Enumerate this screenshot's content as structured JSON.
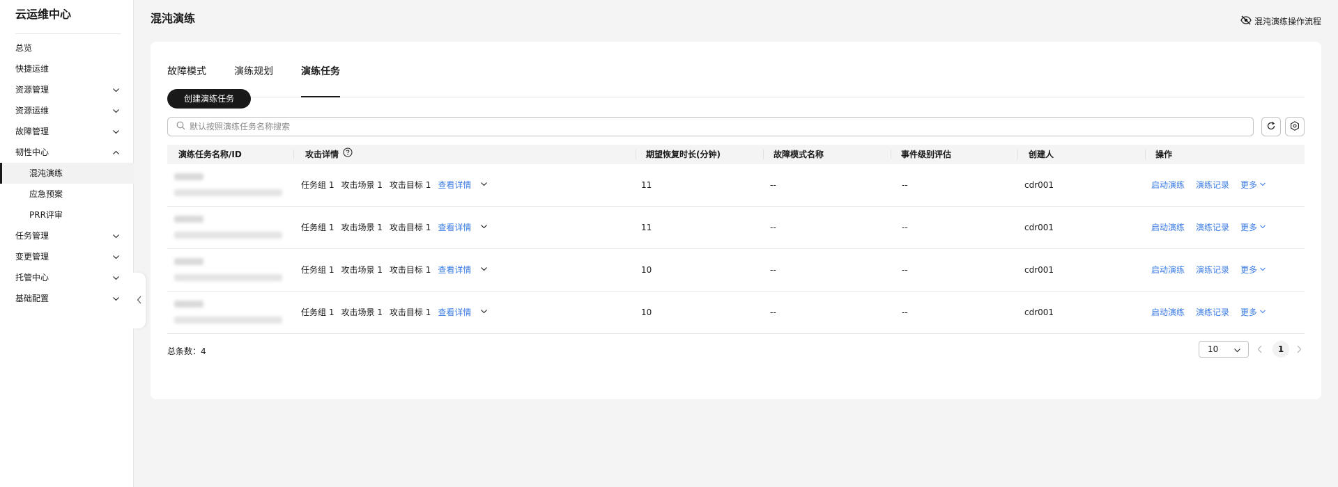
{
  "sidebar": {
    "title": "云运维中心",
    "items": [
      {
        "label": "总览",
        "chevron": "none"
      },
      {
        "label": "快捷运维",
        "chevron": "none"
      },
      {
        "label": "资源管理",
        "chevron": "down"
      },
      {
        "label": "资源运维",
        "chevron": "down"
      },
      {
        "label": "故障管理",
        "chevron": "down"
      },
      {
        "label": "韧性中心",
        "chevron": "up"
      },
      {
        "label": "混沌演练",
        "sub": true,
        "active": true
      },
      {
        "label": "应急预案",
        "sub": true
      },
      {
        "label": "PRR评审",
        "sub": true
      },
      {
        "label": "任务管理",
        "chevron": "down"
      },
      {
        "label": "变更管理",
        "chevron": "down"
      },
      {
        "label": "托管中心",
        "chevron": "down"
      },
      {
        "label": "基础配置",
        "chevron": "down"
      }
    ]
  },
  "header": {
    "title": "混沌演练",
    "flow_link": "混沌演练操作流程",
    "flow_icon": "eye-off-icon"
  },
  "tabs": [
    "故障模式",
    "演练规划",
    "演练任务"
  ],
  "active_tab": "演练任务",
  "toolbar": {
    "create_label": "创建演练任务",
    "search_placeholder": "默认按照演练任务名称搜索"
  },
  "table": {
    "headers": [
      "演练任务名称/ID",
      "攻击详情",
      "期望恢复时长(分钟)",
      "故障模式名称",
      "事件级别评估",
      "创建人",
      "操作"
    ],
    "rows": [
      {
        "attack": [
          "任务组 1",
          "攻击场景 1",
          "攻击目标 1"
        ],
        "detail_link": "查看详情",
        "recovery": "11",
        "fault": "--",
        "event": "--",
        "creator": "cdr001",
        "actions": [
          "启动演练",
          "演练记录",
          "更多"
        ]
      },
      {
        "attack": [
          "任务组 1",
          "攻击场景 1",
          "攻击目标 1"
        ],
        "detail_link": "查看详情",
        "recovery": "11",
        "fault": "--",
        "event": "--",
        "creator": "cdr001",
        "actions": [
          "启动演练",
          "演练记录",
          "更多"
        ]
      },
      {
        "attack": [
          "任务组 1",
          "攻击场景 1",
          "攻击目标 1"
        ],
        "detail_link": "查看详情",
        "recovery": "10",
        "fault": "--",
        "event": "--",
        "creator": "cdr001",
        "actions": [
          "启动演练",
          "演练记录",
          "更多"
        ]
      },
      {
        "attack": [
          "任务组 1",
          "攻击场景 1",
          "攻击目标 1"
        ],
        "detail_link": "查看详情",
        "recovery": "10",
        "fault": "--",
        "event": "--",
        "creator": "cdr001",
        "actions": [
          "启动演练",
          "演练记录",
          "更多"
        ]
      }
    ]
  },
  "footer": {
    "total_label": "总条数：4",
    "page_size": "10",
    "current_page": "1"
  },
  "colors": {
    "link": "#3b7ce4",
    "primary_button": "#191919",
    "page_bg": "#f4f4f4"
  }
}
